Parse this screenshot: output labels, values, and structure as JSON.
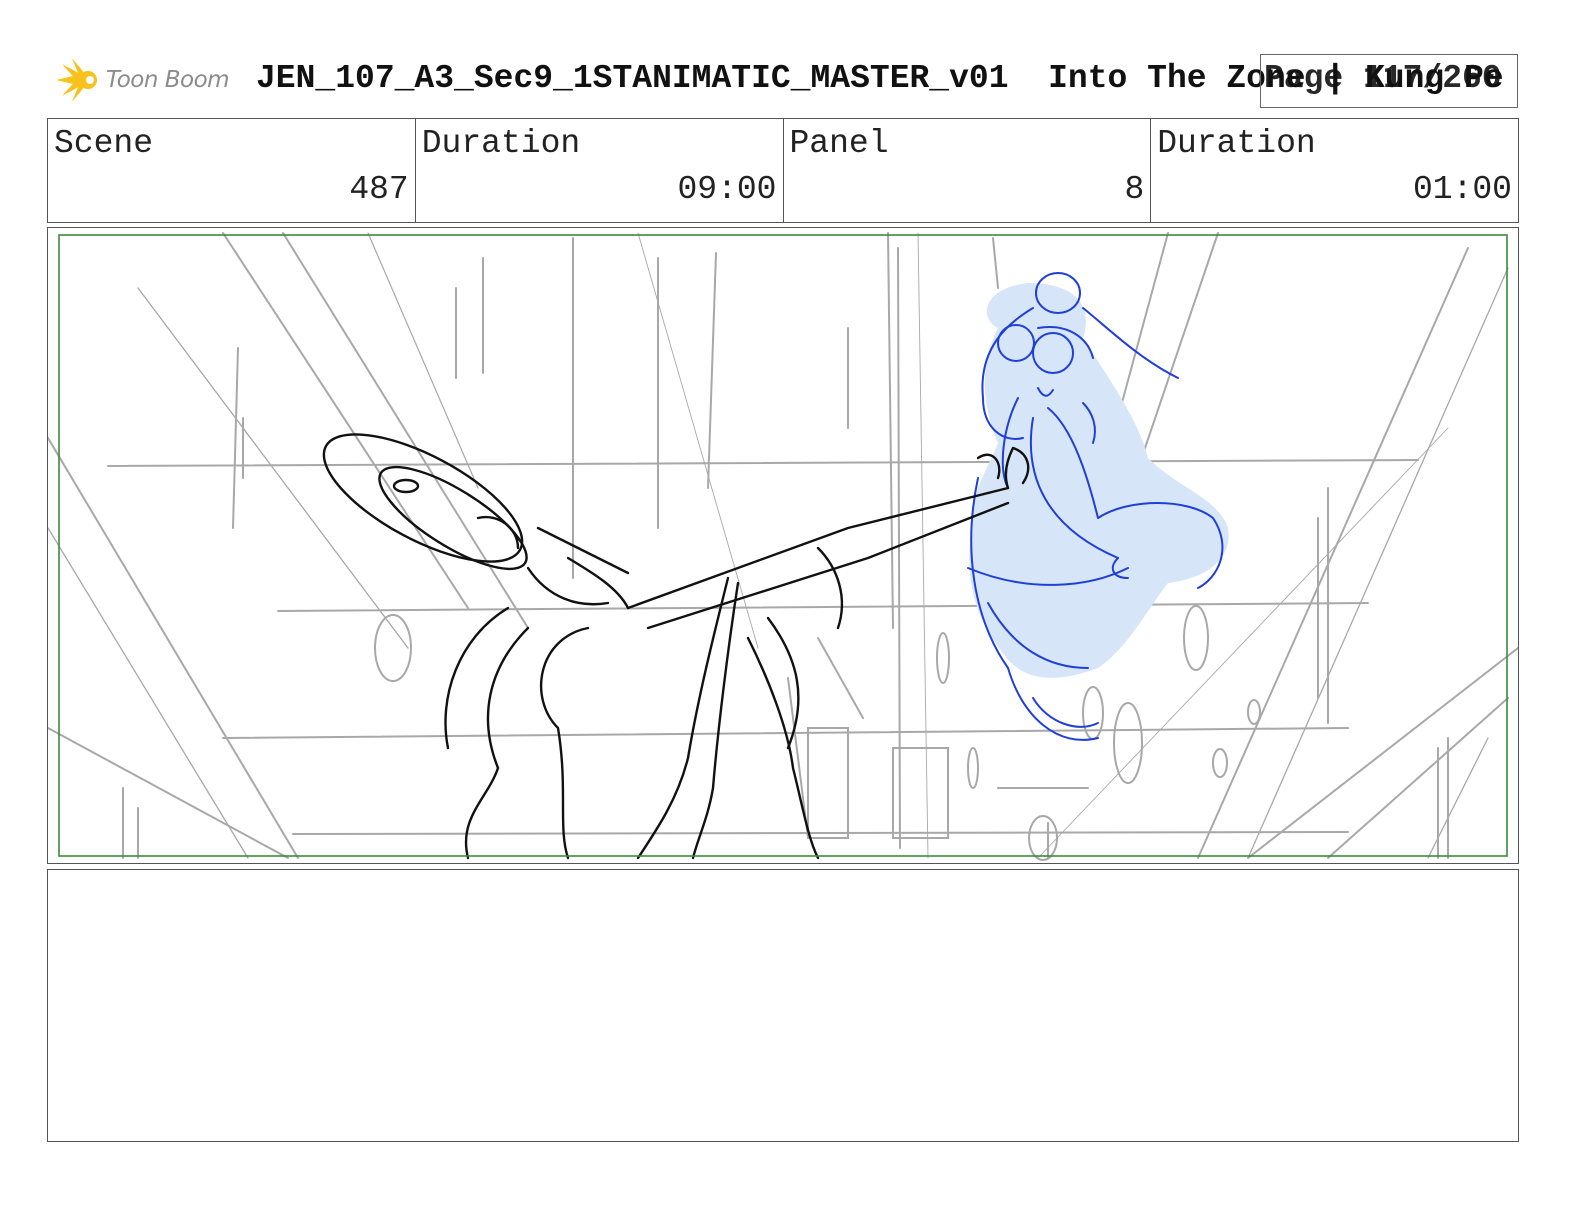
{
  "header": {
    "logo_text": "Toon Boom",
    "title": "JEN_107_A3_Sec9_1STANIMATIC_MASTER_v01  Into The Zone | Kung Pe",
    "page": "Page 117/260"
  },
  "info": {
    "scene_label": "Scene",
    "scene_value": "487",
    "scene_duration_label": "Duration",
    "scene_duration_value": "09:00",
    "panel_label": "Panel",
    "panel_value": "8",
    "panel_duration_label": "Duration",
    "panel_duration_value": "01:00"
  },
  "colors": {
    "safe_frame": "#3c8a3c",
    "sketch_gray": "#a8a8a8",
    "character_blue": "#1f3fd6",
    "character_fill": "#d6e6f8",
    "logo_yellow": "#f7c21b"
  },
  "notes": {
    "text": ""
  }
}
